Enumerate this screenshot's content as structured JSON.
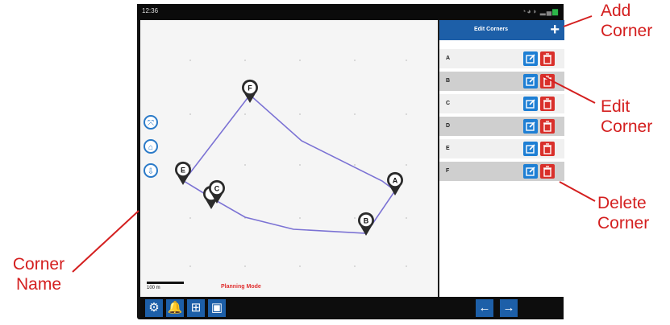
{
  "status": {
    "time": "12:36"
  },
  "panel": {
    "title": "Edit Corners",
    "add_icon": "plus-icon",
    "corners": [
      {
        "label": "A"
      },
      {
        "label": "B"
      },
      {
        "label": "C"
      },
      {
        "label": "D"
      },
      {
        "label": "E"
      },
      {
        "label": "F"
      }
    ]
  },
  "map": {
    "scale_label": "100 m",
    "mode_label": "Planning Mode",
    "markers": [
      "A",
      "B",
      "C",
      "D",
      "E",
      "F"
    ],
    "boundary_color": "#7b72d4"
  },
  "toolbar": {
    "icons": [
      "gear-icon",
      "bell-icon",
      "layout-icon",
      "camera-icon"
    ],
    "nav": [
      "arrow-left-icon",
      "arrow-right-icon"
    ]
  },
  "annotations": {
    "add_corner": [
      "Add",
      "Corner"
    ],
    "edit_corner": [
      "Edit",
      "Corner"
    ],
    "delete_corner": [
      "Delete",
      "Corner"
    ],
    "corner_name": [
      "Corner",
      "Name"
    ]
  },
  "colors": {
    "accent": "#1d5fa8",
    "delete": "#d9302b",
    "edit": "#1e7fd4",
    "annotation": "#d41f1f"
  }
}
